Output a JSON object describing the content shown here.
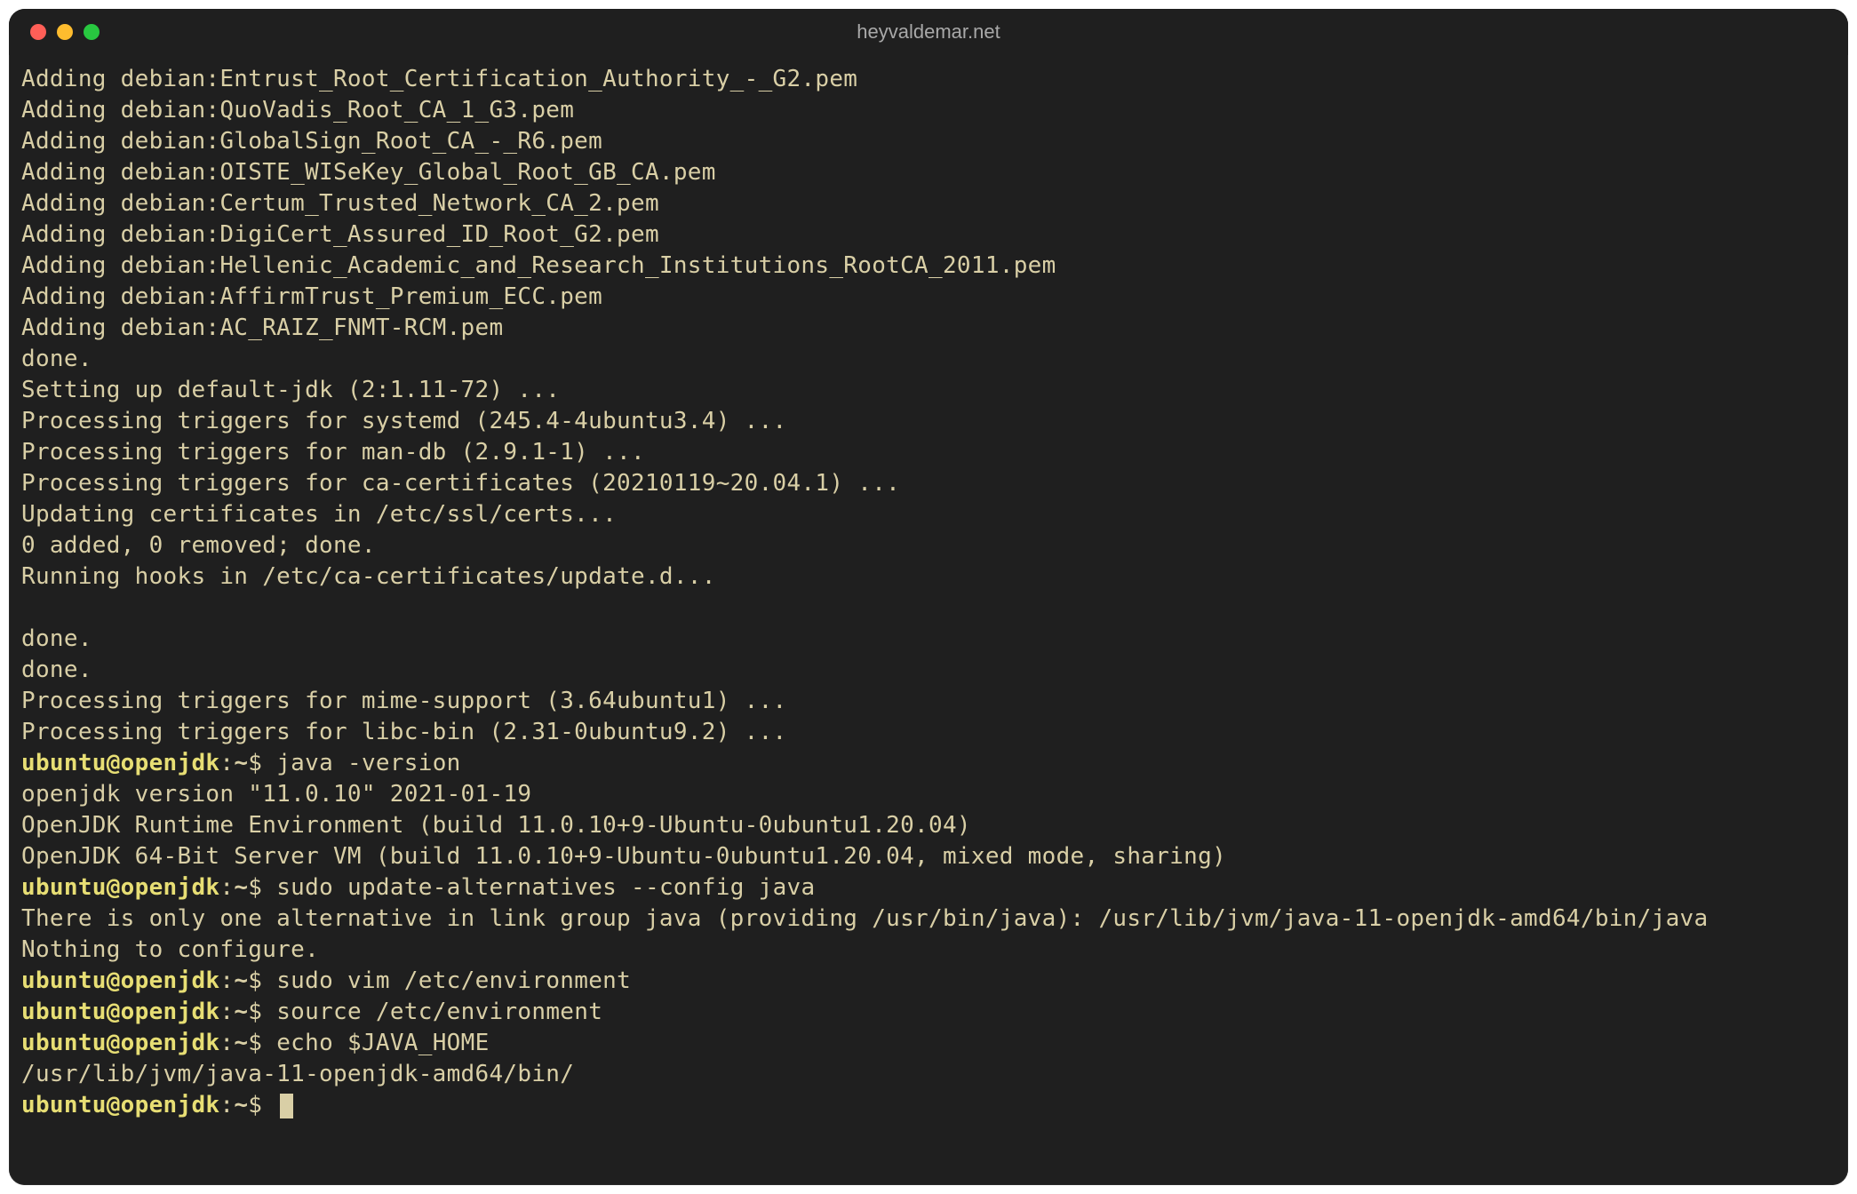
{
  "window": {
    "title": "heyvaldemar.net"
  },
  "output_lines": [
    "Adding debian:Entrust_Root_Certification_Authority_-_G2.pem",
    "Adding debian:QuoVadis_Root_CA_1_G3.pem",
    "Adding debian:GlobalSign_Root_CA_-_R6.pem",
    "Adding debian:OISTE_WISeKey_Global_Root_GB_CA.pem",
    "Adding debian:Certum_Trusted_Network_CA_2.pem",
    "Adding debian:DigiCert_Assured_ID_Root_G2.pem",
    "Adding debian:Hellenic_Academic_and_Research_Institutions_RootCA_2011.pem",
    "Adding debian:AffirmTrust_Premium_ECC.pem",
    "Adding debian:AC_RAIZ_FNMT-RCM.pem",
    "done.",
    "Setting up default-jdk (2:1.11-72) ...",
    "Processing triggers for systemd (245.4-4ubuntu3.4) ...",
    "Processing triggers for man-db (2.9.1-1) ...",
    "Processing triggers for ca-certificates (20210119~20.04.1) ...",
    "Updating certificates in /etc/ssl/certs...",
    "0 added, 0 removed; done.",
    "Running hooks in /etc/ca-certificates/update.d...",
    "",
    "done.",
    "done.",
    "Processing triggers for mime-support (3.64ubuntu1) ...",
    "Processing triggers for libc-bin (2.31-0ubuntu9.2) ..."
  ],
  "prompts": [
    {
      "user": "ubuntu@openjdk",
      "path": "~",
      "cmd": "java -version"
    }
  ],
  "java_version_output": [
    "openjdk version \"11.0.10\" 2021-01-19",
    "OpenJDK Runtime Environment (build 11.0.10+9-Ubuntu-0ubuntu1.20.04)",
    "OpenJDK 64-Bit Server VM (build 11.0.10+9-Ubuntu-0ubuntu1.20.04, mixed mode, sharing)"
  ],
  "prompts2": [
    {
      "user": "ubuntu@openjdk",
      "path": "~",
      "cmd": "sudo update-alternatives --config java"
    }
  ],
  "alt_output": [
    "There is only one alternative in link group java (providing /usr/bin/java): /usr/lib/jvm/java-11-openjdk-amd64/bin/java",
    "Nothing to configure."
  ],
  "prompts3": [
    {
      "user": "ubuntu@openjdk",
      "path": "~",
      "cmd": "sudo vim /etc/environment"
    },
    {
      "user": "ubuntu@openjdk",
      "path": "~",
      "cmd": "source /etc/environment"
    },
    {
      "user": "ubuntu@openjdk",
      "path": "~",
      "cmd": "echo $JAVA_HOME"
    }
  ],
  "echo_output": "/usr/lib/jvm/java-11-openjdk-amd64/bin/",
  "final_prompt": {
    "user": "ubuntu@openjdk",
    "path": "~",
    "cmd": ""
  }
}
